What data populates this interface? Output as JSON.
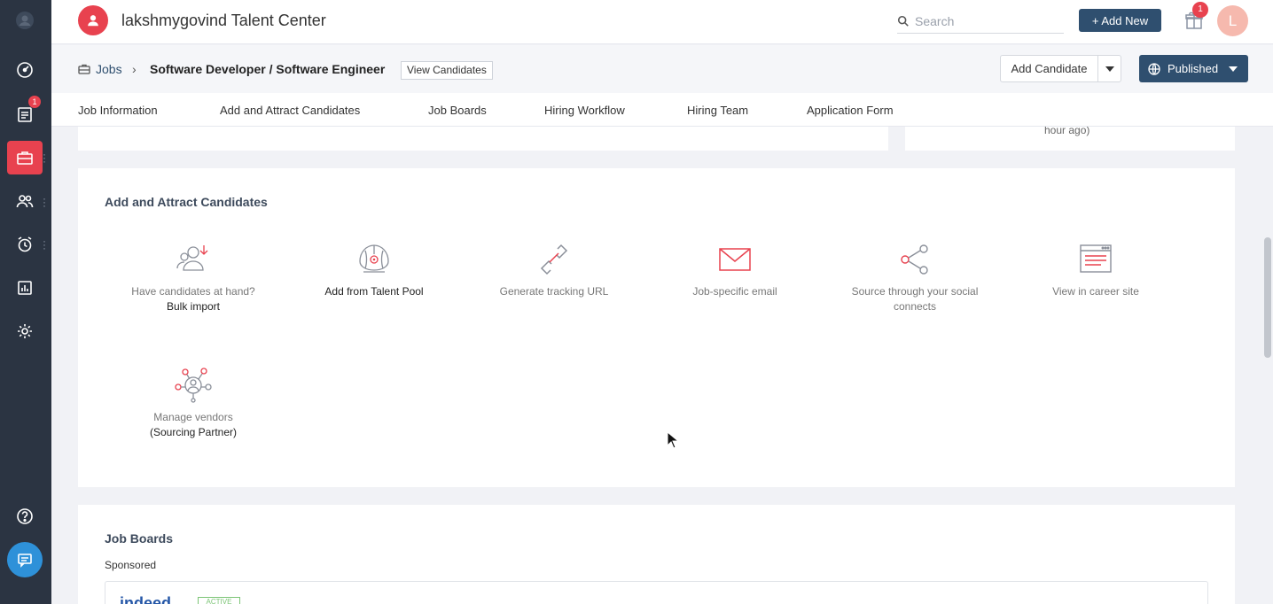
{
  "app": {
    "title": "lakshmygovind Talent Center",
    "logo_icon": "user-icon",
    "accent": "#e8424f",
    "primary": "#2f4f6f"
  },
  "header": {
    "search_placeholder": "Search",
    "add_new_label": "+ Add New",
    "gift_badge": "1",
    "avatar_initial": "L"
  },
  "sidebar": {
    "items": [
      {
        "name": "dashboard",
        "icon": "dashboard-icon"
      },
      {
        "name": "tasks",
        "icon": "tasks-icon",
        "badge": "1"
      },
      {
        "name": "jobs",
        "icon": "briefcase-icon",
        "active": true
      },
      {
        "name": "candidates",
        "icon": "people-icon"
      },
      {
        "name": "interviews",
        "icon": "alarm-icon"
      },
      {
        "name": "reports",
        "icon": "chart-icon"
      },
      {
        "name": "settings",
        "icon": "gear-icon"
      },
      {
        "name": "help",
        "icon": "help-icon"
      },
      {
        "name": "chat",
        "icon": "chat-icon"
      }
    ]
  },
  "breadcrumb": {
    "root": "Jobs",
    "separator": "›",
    "title": "Software Developer / Software Engineer",
    "view_candidates": "View Candidates",
    "add_candidate": "Add Candidate",
    "status": "Published"
  },
  "tabs": [
    {
      "label": "Job Information"
    },
    {
      "label": "Add and Attract Candidates"
    },
    {
      "label": "Job Boards"
    },
    {
      "label": "Hiring Workflow"
    },
    {
      "label": "Hiring Team"
    },
    {
      "label": "Application Form"
    }
  ],
  "top_right_card": {
    "text": "hour ago)"
  },
  "attract": {
    "title": "Add and Attract Candidates",
    "options": [
      {
        "label": "Have candidates at hand?",
        "sub": "Bulk import",
        "icon": "bulk-import-icon"
      },
      {
        "label": "Add from Talent Pool",
        "icon": "talent-pool-icon"
      },
      {
        "label": "Generate tracking URL",
        "icon": "link-icon"
      },
      {
        "label": "Job-specific email",
        "icon": "email-icon"
      },
      {
        "label": "Source through your social connects",
        "icon": "share-icon"
      },
      {
        "label": "View in career site",
        "icon": "browser-icon"
      },
      {
        "label": "Manage vendors",
        "sub": "(Sourcing Partner)",
        "icon": "vendors-icon"
      }
    ]
  },
  "job_boards": {
    "title": "Job Boards",
    "sponsored": "Sponsored",
    "board_name": "indeed",
    "board_status": "ACTIVE"
  }
}
